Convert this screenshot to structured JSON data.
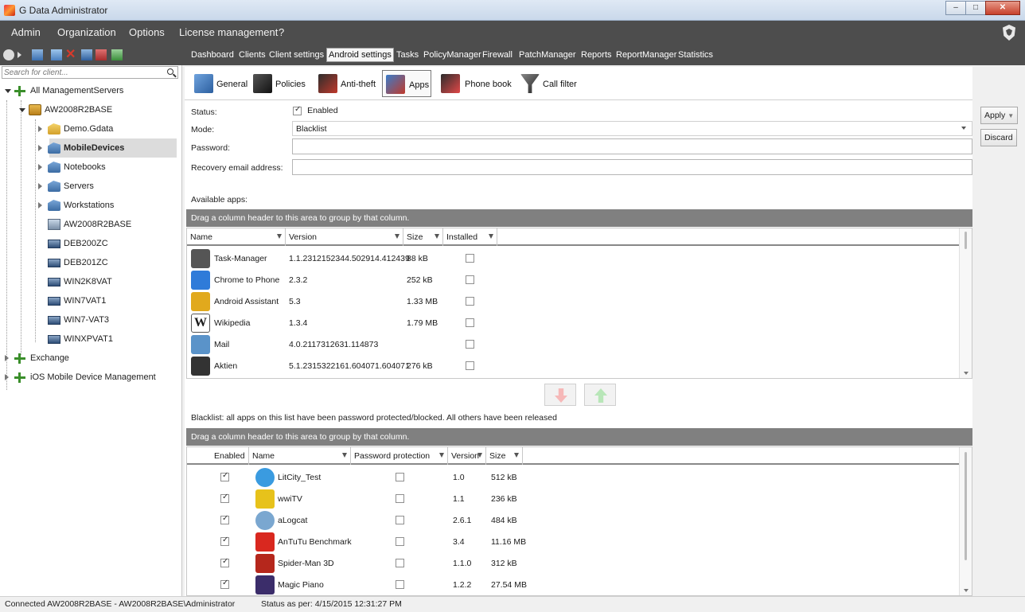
{
  "window": {
    "title": "G Data Administrator"
  },
  "menu": [
    "Admin",
    "Organization",
    "Options",
    "License management",
    "?"
  ],
  "module_tabs": [
    "Dashboard",
    "Clients",
    "Client settings",
    "Android settings",
    "Tasks",
    "PolicyManager",
    "Firewall",
    "PatchManager",
    "Reports",
    "ReportManager",
    "Statistics"
  ],
  "active_module_tab": "Android settings",
  "search": {
    "placeholder": "Search for client..."
  },
  "tree": [
    {
      "label": "All ManagementServers",
      "level": 0,
      "icon": "plus-network-icon",
      "expanded": true
    },
    {
      "label": "AW2008R2BASE",
      "level": 1,
      "icon": "server-icon",
      "expanded": true
    },
    {
      "label": "Demo.Gdata",
      "level": 2,
      "icon": "group-icon",
      "expanded": false
    },
    {
      "label": "MobileDevices",
      "level": 2,
      "icon": "group-icon",
      "expanded": false,
      "selected": true
    },
    {
      "label": "Notebooks",
      "level": 2,
      "icon": "group-icon",
      "expanded": false
    },
    {
      "label": "Servers",
      "level": 2,
      "icon": "group-icon",
      "expanded": false
    },
    {
      "label": "Workstations",
      "level": 2,
      "icon": "group-icon",
      "expanded": false
    },
    {
      "label": "AW2008R2BASE",
      "level": 2,
      "icon": "cluster-icon"
    },
    {
      "label": "DEB200ZC",
      "level": 2,
      "icon": "pc-icon"
    },
    {
      "label": "DEB201ZC",
      "level": 2,
      "icon": "pc-icon"
    },
    {
      "label": "WIN2K8VAT",
      "level": 2,
      "icon": "pc-icon"
    },
    {
      "label": "WIN7VAT1",
      "level": 2,
      "icon": "pc-icon"
    },
    {
      "label": "WIN7-VAT3",
      "level": 2,
      "icon": "pc-icon"
    },
    {
      "label": "WINXPVAT1",
      "level": 2,
      "icon": "pc-icon"
    },
    {
      "label": "Exchange",
      "level": 0,
      "icon": "plus-network-icon",
      "expanded": false
    },
    {
      "label": "iOS Mobile Device Management",
      "level": 0,
      "icon": "plus-network-icon",
      "expanded": false
    }
  ],
  "sub_tabs": [
    {
      "label": "General",
      "color": "#3a6fb0"
    },
    {
      "label": "Policies",
      "color": "#2b2b2b"
    },
    {
      "label": "Anti-theft",
      "color": "#c0392b"
    },
    {
      "label": "Apps",
      "color": "#1f5fa8"
    },
    {
      "label": "Phone book",
      "color": "#d13b3b"
    },
    {
      "label": "Call filter",
      "color": "#444444"
    }
  ],
  "active_sub_tab": "Apps",
  "form": {
    "status_label": "Status:",
    "status_value": "Enabled",
    "status_checked": true,
    "mode_label": "Mode:",
    "mode_value": "Blacklist",
    "password_label": "Password:",
    "password_value": "",
    "recovery_label": "Recovery email address:",
    "recovery_value": ""
  },
  "available_apps": {
    "title": "Available apps:",
    "group_hint": "Drag a column header to this area to group by that column.",
    "columns": [
      "Name",
      "Version",
      "Size",
      "Installed"
    ],
    "rows": [
      {
        "name": "Task-Manager",
        "version": "1.1.2312152344.502914.412439",
        "size": "88 kB",
        "installed": false,
        "icon": "task-manager-icon",
        "color": "#555555"
      },
      {
        "name": "Chrome to Phone",
        "version": "2.3.2",
        "size": "252 kB",
        "installed": false,
        "icon": "chrome-to-phone-icon",
        "color": "#2f7bd9"
      },
      {
        "name": "Android Assistant",
        "version": "5.3",
        "size": "1.33 MB",
        "installed": false,
        "icon": "android-assistant-icon",
        "color": "#e1a91d"
      },
      {
        "name": "Wikipedia",
        "version": "1.3.4",
        "size": "1.79 MB",
        "installed": false,
        "icon": "wikipedia-icon",
        "color": "#ffffff"
      },
      {
        "name": "Mail",
        "version": "4.0.2117312631.114873",
        "size": "",
        "installed": false,
        "icon": "mail-icon",
        "color": "#5a93c9"
      },
      {
        "name": "Aktien",
        "version": "5.1.2315322161.604071.604071",
        "size": "276 kB",
        "installed": false,
        "icon": "stocks-icon",
        "color": "#333333"
      }
    ]
  },
  "blacklist": {
    "title": "Blacklist: all apps on this list have been password protected/blocked. All others have been released",
    "group_hint": "Drag a column header to this area to group by that column.",
    "columns": [
      "Enabled",
      "Name",
      "Password protection",
      "Version",
      "Size"
    ],
    "rows": [
      {
        "enabled": true,
        "name": "LitCity_Test",
        "password": false,
        "version": "1.0",
        "size": "512 kB",
        "icon": "litcity-icon",
        "color": "#3a9be0"
      },
      {
        "enabled": true,
        "name": "wwiTV",
        "password": false,
        "version": "1.1",
        "size": "236 kB",
        "icon": "wwitv-icon",
        "color": "#e7c21b"
      },
      {
        "enabled": true,
        "name": "aLogcat",
        "password": false,
        "version": "2.6.1",
        "size": "484 kB",
        "icon": "alogcat-icon",
        "color": "#7aa7d0"
      },
      {
        "enabled": true,
        "name": "AnTuTu Benchmark",
        "password": false,
        "version": "3.4",
        "size": "11.16 MB",
        "icon": "antutu-icon",
        "color": "#d9281f"
      },
      {
        "enabled": true,
        "name": "Spider-Man 3D",
        "password": false,
        "version": "1.1.0",
        "size": "312 kB",
        "icon": "spiderman-icon",
        "color": "#b5271c"
      },
      {
        "enabled": true,
        "name": "Magic Piano",
        "password": false,
        "version": "1.2.2",
        "size": "27.54 MB",
        "icon": "magic-piano-icon",
        "color": "#3b2d6a"
      }
    ]
  },
  "actions": {
    "apply": "Apply",
    "discard": "Discard"
  },
  "status": {
    "connection": "Connected AW2008R2BASE - AW2008R2BASE\\Administrator",
    "status_as_per": "Status as per: 4/15/2015 12:31:27 PM"
  }
}
